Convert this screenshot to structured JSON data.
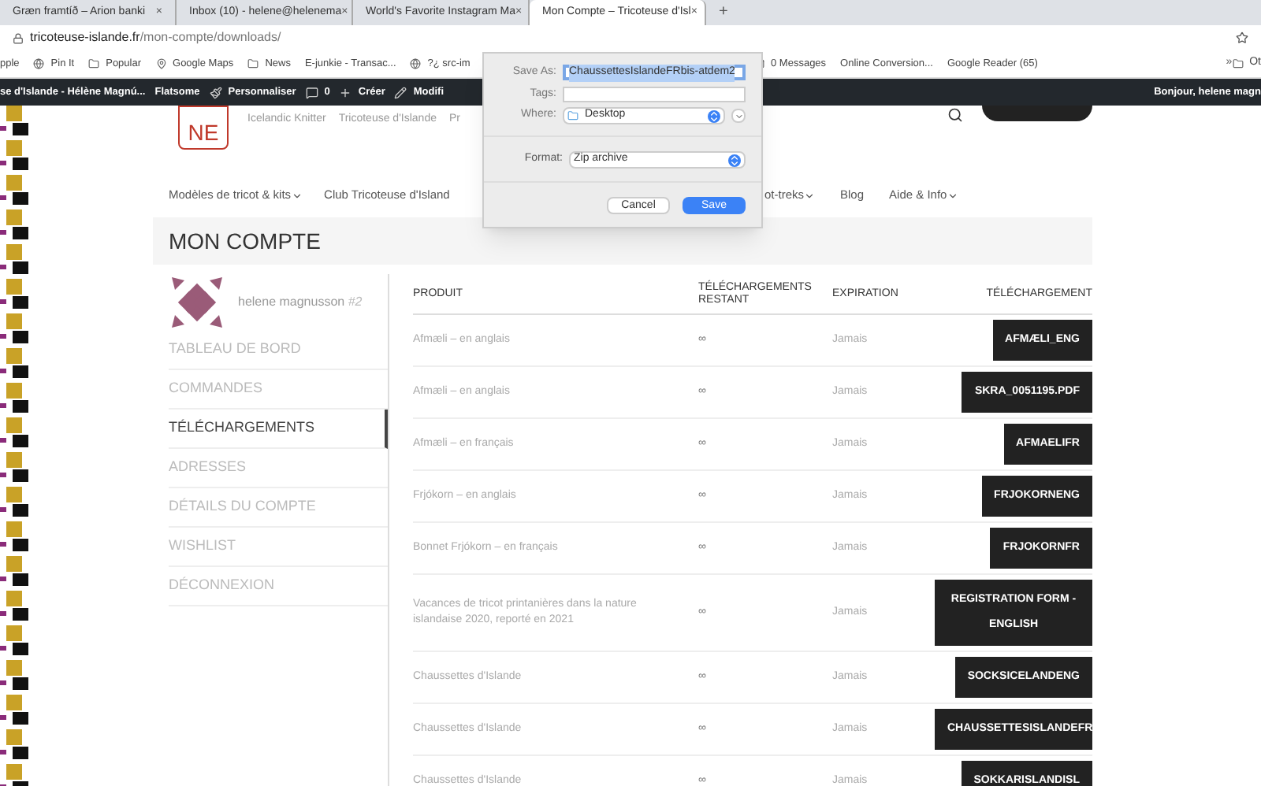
{
  "browser": {
    "tabs": [
      {
        "title": "Græn framtíð – Arion banki",
        "close": "×",
        "selected": false
      },
      {
        "title": "Inbox (10) - helene@helenema",
        "close": "×",
        "selected": false
      },
      {
        "title": "World's Favorite Instagram Ma",
        "close": "×",
        "selected": false
      },
      {
        "title": "Mon Compte – Tricoteuse d'Isl",
        "close": "×",
        "selected": true
      }
    ],
    "new_tab": "+",
    "url": {
      "host": "tricoteuse-islande.fr",
      "path": "/mon-compte/downloads/"
    },
    "bookmarks": [
      "pple",
      "Pin It",
      "Popular",
      "Google Maps",
      "News",
      "E-junkie - Transac...",
      "?¿ src-im",
      "0 Messages",
      "Online Conversion...",
      "Google Reader (65)"
    ],
    "bookmarks_more": "»",
    "other_bookmarks": "Ot"
  },
  "admin_bar": {
    "items": [
      "se d'Islande - Hélène Magnú...",
      "Flatsome",
      "Personnaliser",
      "0",
      "Créer",
      "Modifi"
    ],
    "greeting": "Bonjour, helene magn"
  },
  "header": {
    "logo": "NE",
    "links": [
      "Icelandic Knitter",
      "Tricoteuse d'Islande",
      "Pr"
    ]
  },
  "nav": [
    {
      "label": "Modèles de tricot & kits",
      "dropdown": true
    },
    {
      "label": "Club Tricoteuse d'Island",
      "dropdown": false
    },
    {
      "label": "ot-treks",
      "dropdown": true
    },
    {
      "label": "Blog",
      "dropdown": false
    },
    {
      "label": "Aide & Info",
      "dropdown": true
    }
  ],
  "page_title": "MON COMPTE",
  "account": {
    "user": "helene magnusson",
    "user_id": "#2",
    "menu": [
      {
        "label": "TABLEAU DE BORD",
        "selected": false
      },
      {
        "label": "COMMANDES",
        "selected": false
      },
      {
        "label": "TÉLÉCHARGEMENTS",
        "selected": true
      },
      {
        "label": "ADRESSES",
        "selected": false
      },
      {
        "label": "DÉTAILS DU COMPTE",
        "selected": false
      },
      {
        "label": "WISHLIST",
        "selected": false
      },
      {
        "label": "DÉCONNEXION",
        "selected": false
      }
    ]
  },
  "table": {
    "columns": [
      "PRODUIT",
      "TÉLÉCHARGEMENTS RESTANT",
      "EXPIRATION",
      "TÉLÉCHARGEMENT"
    ],
    "rows": [
      {
        "product": "Afmæli – en anglais",
        "remaining": "∞",
        "expiration": "Jamais",
        "download": "AFMÆLI_ENG"
      },
      {
        "product": "Afmæli – en anglais",
        "remaining": "∞",
        "expiration": "Jamais",
        "download": "SKRA_0051195.PDF"
      },
      {
        "product": "Afmæli – en français",
        "remaining": "∞",
        "expiration": "Jamais",
        "download": "AFMAELIFR"
      },
      {
        "product": "Frjókorn – en anglais",
        "remaining": "∞",
        "expiration": "Jamais",
        "download": "FRJOKORNENG"
      },
      {
        "product": "Bonnet Frjókorn – en français",
        "remaining": "∞",
        "expiration": "Jamais",
        "download": "FRJOKORNFR"
      },
      {
        "product": "Vacances de tricot printanières dans la nature islandaise 2020, reporté en 2021",
        "remaining": "∞",
        "expiration": "Jamais",
        "download": "REGISTRATION FORM - ENGLISH"
      },
      {
        "product": "Chaussettes d'Islande",
        "remaining": "∞",
        "expiration": "Jamais",
        "download": "SOCKSICELANDENG"
      },
      {
        "product": "Chaussettes d'Islande",
        "remaining": "∞",
        "expiration": "Jamais",
        "download": "CHAUSSETTESISLANDEFR"
      },
      {
        "product": "Chaussettes d'Islande",
        "remaining": "∞",
        "expiration": "Jamais",
        "download": "SOKKARISLANDISL"
      }
    ]
  },
  "save_dialog": {
    "save_as_label": "Save As:",
    "save_as_value": "ChaussettesIslandeFRbis-atdem2",
    "tags_label": "Tags:",
    "where_label": "Where:",
    "where_value": "Desktop",
    "format_label": "Format:",
    "format_value": "Zip archive",
    "buttons": [
      {
        "label": "Cancel",
        "kind": "secondary"
      },
      {
        "label": "Save",
        "kind": "primary"
      }
    ]
  }
}
